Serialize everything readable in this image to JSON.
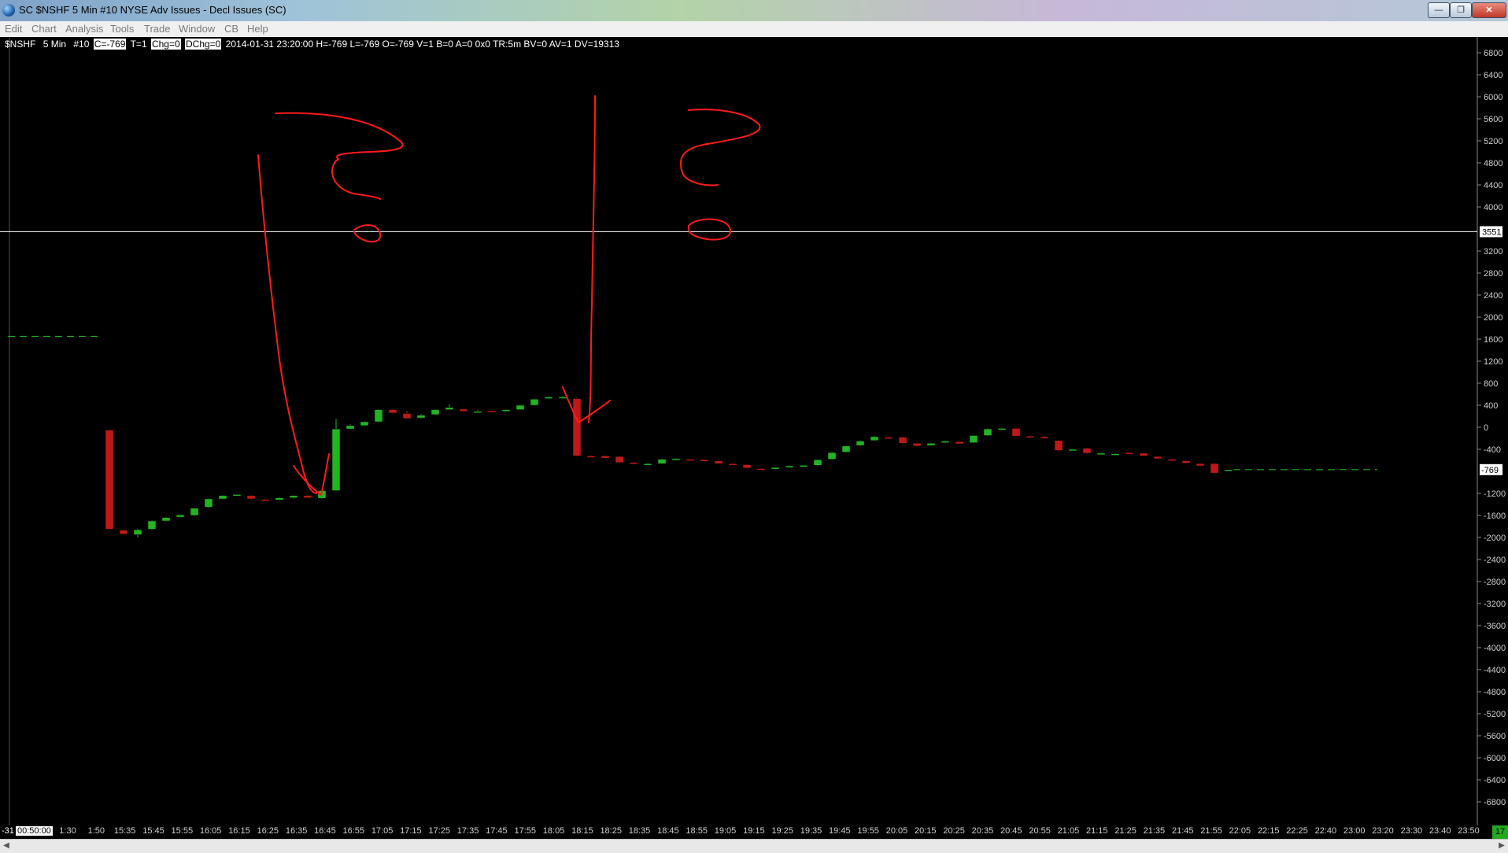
{
  "window": {
    "title": "SC $NSHF  5 Min   #10  NYSE Adv Issues - Decl Issues (SC)",
    "minimize_icon": "minimize-icon",
    "maximize_icon": "restore-icon",
    "close_icon": "close-icon"
  },
  "menu": [
    "Edit",
    "Chart",
    "Analysis",
    "Tools",
    "Trade",
    "Window",
    "CB",
    "Help"
  ],
  "info_bar": {
    "symbol": "$NSHF",
    "interval": "5 Min",
    "chart_num": "#10",
    "close": "C=-769",
    "trades": "T=1",
    "chg": "Chg=0",
    "dchg": "DChg=0",
    "rest": "2014-01-31 23:20:00 H=-769 L=-769 O=-769 V=1 B=0 A=0 0x0 TR:5m BV=0 AV=1 DV=19313"
  },
  "colors": {
    "background": "#000000",
    "up_candle": "#22b422",
    "down_candle": "#c01818",
    "annotation": "#ff1a1a",
    "crosshair": "#ffffff",
    "projection": "#1faa1f"
  },
  "axis": {
    "last_price_label": "-769",
    "crosshair_label": "3551",
    "corner_box": "17",
    "x_first_label": "-31",
    "x_second_label": "00:50:00"
  },
  "chart_data": {
    "type": "candlestick",
    "ylim": [
      -7000,
      7000
    ],
    "yticks": [
      6800,
      6400,
      6000,
      5600,
      5200,
      4800,
      4400,
      4000,
      3200,
      2800,
      2400,
      2000,
      1600,
      1200,
      800,
      400,
      0,
      -400,
      -1200,
      -1600,
      -2000,
      -2400,
      -2800,
      -3200,
      -3600,
      -4000,
      -4400,
      -4800,
      -5200,
      -5600,
      -6000,
      -6400,
      -6800
    ],
    "crosshair_value": 3551,
    "last_value": -769,
    "x_labels": [
      "1:30",
      "1:50",
      "15:35",
      "15:45",
      "15:55",
      "16:05",
      "16:15",
      "16:25",
      "16:35",
      "16:45",
      "16:55",
      "17:05",
      "17:15",
      "17:25",
      "17:35",
      "17:45",
      "17:55",
      "18:05",
      "18:15",
      "18:25",
      "18:35",
      "18:45",
      "18:55",
      "19:05",
      "19:15",
      "19:25",
      "19:35",
      "19:45",
      "19:55",
      "20:05",
      "20:15",
      "20:25",
      "20:35",
      "20:45",
      "20:55",
      "21:05",
      "21:15",
      "21:25",
      "21:35",
      "21:45",
      "21:55",
      "22:05",
      "22:15",
      "22:25",
      "22:40",
      "23:00",
      "23:20",
      "23:30",
      "23:40",
      "23:50"
    ],
    "previous_close_level": 1650,
    "candles": [
      {
        "o": -50,
        "c": -1850,
        "h": -50,
        "l": -1850
      },
      {
        "o": -1870,
        "c": -1940,
        "h": -1850,
        "l": -1950
      },
      {
        "o": -1950,
        "c": -1860,
        "h": -1840,
        "l": -2000
      },
      {
        "o": -1850,
        "c": -1700,
        "h": -1690,
        "l": -1860
      },
      {
        "o": -1700,
        "c": -1640,
        "h": -1630,
        "l": -1710
      },
      {
        "o": -1630,
        "c": -1590,
        "h": -1580,
        "l": -1640
      },
      {
        "o": -1600,
        "c": -1470,
        "h": -1460,
        "l": -1610
      },
      {
        "o": -1450,
        "c": -1300,
        "h": -1290,
        "l": -1460
      },
      {
        "o": -1300,
        "c": -1240,
        "h": -1230,
        "l": -1310
      },
      {
        "o": -1240,
        "c": -1220,
        "h": -1210,
        "l": -1250
      },
      {
        "o": -1240,
        "c": -1300,
        "h": -1230,
        "l": -1310
      },
      {
        "o": -1310,
        "c": -1330,
        "h": -1300,
        "l": -1340
      },
      {
        "o": -1320,
        "c": -1280,
        "h": -1270,
        "l": -1330
      },
      {
        "o": -1280,
        "c": -1240,
        "h": -1230,
        "l": -1290
      },
      {
        "o": -1240,
        "c": -1280,
        "h": -1230,
        "l": -1290
      },
      {
        "o": -1290,
        "c": -1150,
        "h": -1140,
        "l": -1300
      },
      {
        "o": -1150,
        "c": -30,
        "h": 150,
        "l": -1160
      },
      {
        "o": -30,
        "c": 30,
        "h": 50,
        "l": -40
      },
      {
        "o": 30,
        "c": 100,
        "h": 110,
        "l": 20
      },
      {
        "o": 100,
        "c": 320,
        "h": 330,
        "l": 90
      },
      {
        "o": 320,
        "c": 260,
        "h": 330,
        "l": 250
      },
      {
        "o": 250,
        "c": 160,
        "h": 300,
        "l": 150
      },
      {
        "o": 170,
        "c": 220,
        "h": 240,
        "l": 160
      },
      {
        "o": 230,
        "c": 320,
        "h": 330,
        "l": 220
      },
      {
        "o": 320,
        "c": 360,
        "h": 420,
        "l": 310
      },
      {
        "o": 330,
        "c": 290,
        "h": 340,
        "l": 280
      },
      {
        "o": 290,
        "c": 290,
        "h": 310,
        "l": 270
      },
      {
        "o": 300,
        "c": 280,
        "h": 310,
        "l": 270
      },
      {
        "o": 290,
        "c": 320,
        "h": 330,
        "l": 280
      },
      {
        "o": 320,
        "c": 400,
        "h": 410,
        "l": 310
      },
      {
        "o": 400,
        "c": 510,
        "h": 520,
        "l": 390
      },
      {
        "o": 520,
        "c": 550,
        "h": 560,
        "l": 510
      },
      {
        "o": 540,
        "c": 550,
        "h": 570,
        "l": 530
      },
      {
        "o": 520,
        "c": -520,
        "h": 540,
        "l": -530
      },
      {
        "o": -520,
        "c": -540,
        "h": -510,
        "l": -550
      },
      {
        "o": -520,
        "c": -560,
        "h": -510,
        "l": -570
      },
      {
        "o": -530,
        "c": -640,
        "h": -520,
        "l": -650
      },
      {
        "o": -640,
        "c": -650,
        "h": -630,
        "l": -660
      },
      {
        "o": -660,
        "c": -660,
        "h": -650,
        "l": -670
      },
      {
        "o": -660,
        "c": -580,
        "h": -570,
        "l": -670
      },
      {
        "o": -570,
        "c": -570,
        "h": -560,
        "l": -580
      },
      {
        "o": -580,
        "c": -590,
        "h": -570,
        "l": -600
      },
      {
        "o": -590,
        "c": -610,
        "h": -580,
        "l": -620
      },
      {
        "o": -610,
        "c": -660,
        "h": -600,
        "l": -670
      },
      {
        "o": -660,
        "c": -680,
        "h": -650,
        "l": -690
      },
      {
        "o": -680,
        "c": -740,
        "h": -670,
        "l": -750
      },
      {
        "o": -750,
        "c": -760,
        "h": -740,
        "l": -770
      },
      {
        "o": -760,
        "c": -730,
        "h": -720,
        "l": -770
      },
      {
        "o": -730,
        "c": -700,
        "h": -690,
        "l": -740
      },
      {
        "o": -700,
        "c": -690,
        "h": -680,
        "l": -710
      },
      {
        "o": -690,
        "c": -590,
        "h": -580,
        "l": -700
      },
      {
        "o": -580,
        "c": -460,
        "h": -450,
        "l": -590
      },
      {
        "o": -450,
        "c": -340,
        "h": -330,
        "l": -460
      },
      {
        "o": -330,
        "c": -250,
        "h": -240,
        "l": -340
      },
      {
        "o": -240,
        "c": -170,
        "h": -160,
        "l": -250
      },
      {
        "o": -180,
        "c": -200,
        "h": -170,
        "l": -210
      },
      {
        "o": -180,
        "c": -290,
        "h": -170,
        "l": -300
      },
      {
        "o": -290,
        "c": -340,
        "h": -280,
        "l": -350
      },
      {
        "o": -330,
        "c": -290,
        "h": -280,
        "l": -340
      },
      {
        "o": -280,
        "c": -250,
        "h": -240,
        "l": -290
      },
      {
        "o": -260,
        "c": -300,
        "h": -250,
        "l": -310
      },
      {
        "o": -280,
        "c": -150,
        "h": -140,
        "l": -290
      },
      {
        "o": -150,
        "c": -30,
        "h": -20,
        "l": -160
      },
      {
        "o": -30,
        "c": -20,
        "h": -10,
        "l": -40
      },
      {
        "o": -20,
        "c": -160,
        "h": -10,
        "l": -170
      },
      {
        "o": -160,
        "c": -170,
        "h": -150,
        "l": -180
      },
      {
        "o": -170,
        "c": -200,
        "h": -160,
        "l": -210
      },
      {
        "o": -240,
        "c": -420,
        "h": -230,
        "l": -430
      },
      {
        "o": -400,
        "c": -400,
        "h": -390,
        "l": -410
      },
      {
        "o": -380,
        "c": -470,
        "h": -370,
        "l": -480
      },
      {
        "o": -470,
        "c": -470,
        "h": -460,
        "l": -480
      },
      {
        "o": -480,
        "c": -480,
        "h": -470,
        "l": -490
      },
      {
        "o": -460,
        "c": -470,
        "h": -450,
        "l": -480
      },
      {
        "o": -470,
        "c": -520,
        "h": -460,
        "l": -530
      },
      {
        "o": -530,
        "c": -570,
        "h": -520,
        "l": -580
      },
      {
        "o": -580,
        "c": -600,
        "h": -570,
        "l": -610
      },
      {
        "o": -610,
        "c": -650,
        "h": -600,
        "l": -660
      },
      {
        "o": -660,
        "c": -700,
        "h": -650,
        "l": -710
      },
      {
        "o": -660,
        "c": -830,
        "h": -650,
        "l": -840
      },
      {
        "o": -769,
        "c": -769,
        "h": -769,
        "l": -769
      }
    ]
  }
}
